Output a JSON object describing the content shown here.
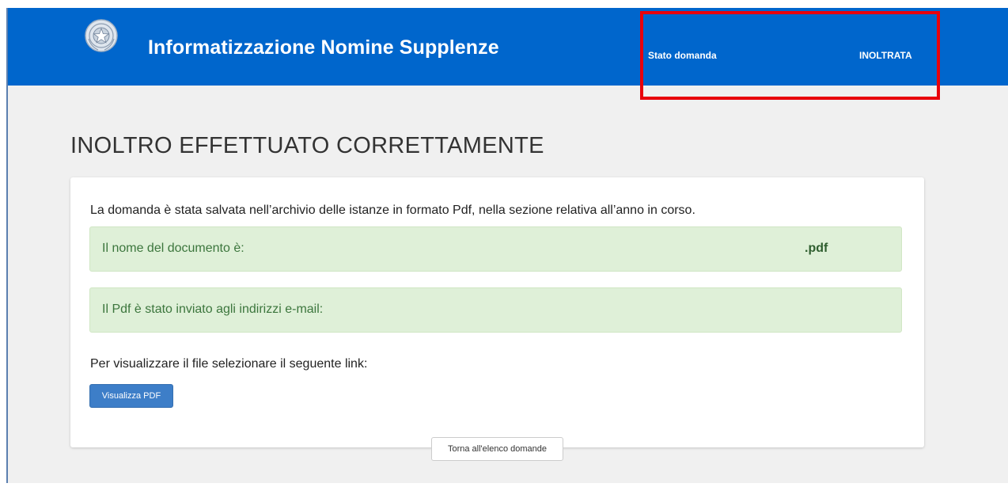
{
  "header": {
    "app_title": "Informatizzazione Nomine Supplenze",
    "status_label": "Stato domanda",
    "status_value": "INOLTRATA",
    "logo_icon": "emblem-icon",
    "background_color": "#0066cc"
  },
  "highlight_color": "#e8000b",
  "main": {
    "page_title": "INOLTRO EFFETTUATO CORRETTAMENTE",
    "intro_text": "La domanda è stata salvata nell’archivio delle istanze in formato Pdf, nella sezione relativa all’anno in corso.",
    "document_name_label": "Il nome del documento è:",
    "document_name_value": ".pdf",
    "email_label": "Il Pdf è stato inviato agli indirizzi e-mail:",
    "link_text": "Per visualizzare il file selezionare il seguente link:",
    "view_pdf_button": "Visualizza PDF",
    "back_button": "Torna all'elenco domande"
  }
}
